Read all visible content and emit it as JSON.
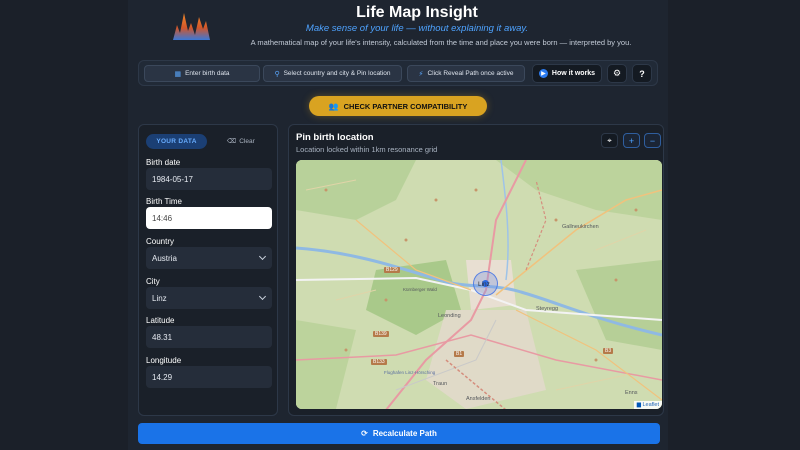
{
  "header": {
    "title": "Life Map Insight",
    "tagline": "Make sense of your life — without explaining it away.",
    "subline": "A mathematical map of your life's intensity, calculated from the time and place you were born — interpreted by you."
  },
  "toolbar": {
    "step1": "Enter birth data",
    "step2": "Select country and city & Pin location",
    "step3": "Click Reveal Path once active",
    "how_it_works": "How it works",
    "help": "?"
  },
  "partner_button": "CHECK PARTNER COMPATIBILITY",
  "form": {
    "tab": "YOUR DATA",
    "clear": "Clear",
    "birth_date_label": "Birth date",
    "birth_date": "1984-05-17",
    "birth_time_label": "Birth Time",
    "birth_time": "14:46",
    "country_label": "Country",
    "country": "Austria",
    "city_label": "City",
    "city": "Linz",
    "latitude_label": "Latitude",
    "latitude": "48.31",
    "longitude_label": "Longitude",
    "longitude": "14.29"
  },
  "map": {
    "title": "Pin birth location",
    "subtitle": "Location locked within 1km resonance grid",
    "attribution": "Leaflet",
    "labels": {
      "linz": "Linz",
      "leonding": "Leonding",
      "steyregg": "Steyregg",
      "gallneukirchen": "Gallneukirchen",
      "traun": "Traun",
      "ansfelden": "Ansfelden",
      "enns": "Enns",
      "kurnberg": "Kürnberger Wald",
      "flughafen": "Flughafen Linz-Hörsching"
    },
    "roads": {
      "b129": "B129",
      "b139": "B139",
      "b133": "B133",
      "b1": "B1",
      "b3": "B3"
    }
  },
  "recalculate": "Recalculate Path",
  "colors": {
    "accent": "#1a73e8",
    "gold": "#d9a321",
    "tab": "#68adff"
  }
}
